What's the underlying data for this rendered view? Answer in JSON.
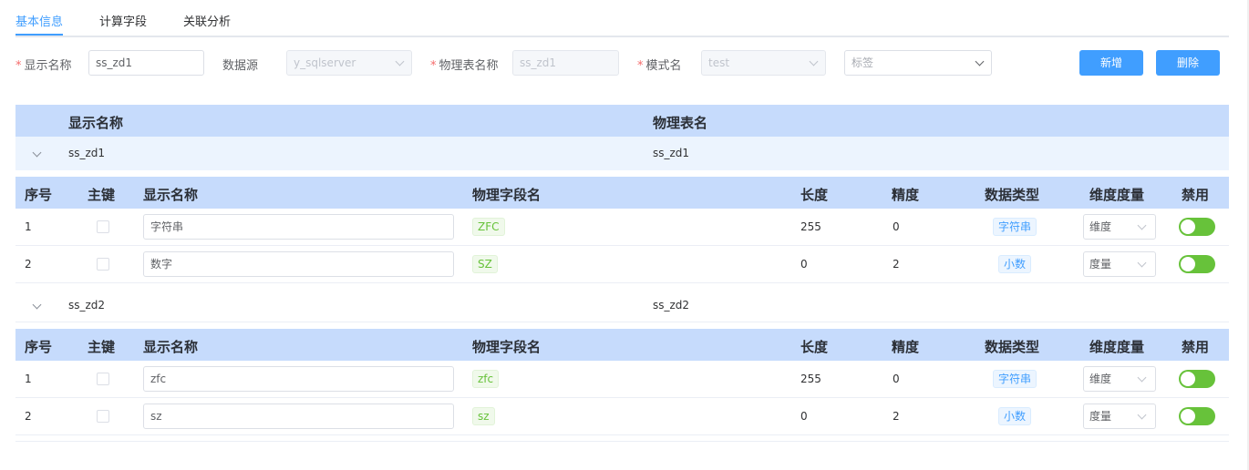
{
  "tabs": [
    {
      "label": "基本信息",
      "active": true
    },
    {
      "label": "计算字段",
      "active": false
    },
    {
      "label": "关联分析",
      "active": false
    }
  ],
  "form": {
    "display_name_label": "显示名称",
    "display_name_value": "ss_zd1",
    "datasource_label": "数据源",
    "datasource_value": "y_sqlserver",
    "physical_table_label": "物理表名称",
    "physical_table_value": "ss_zd1",
    "schema_label": "模式名",
    "schema_value": "test",
    "tag_placeholder": "标签",
    "add_button": "新增",
    "delete_button": "删除"
  },
  "master_table": {
    "columns": [
      "显示名称",
      "物理表名"
    ]
  },
  "detail_columns": [
    "序号",
    "主键",
    "显示名称",
    "物理字段名",
    "长度",
    "精度",
    "数据类型",
    "维度度量",
    "禁用"
  ],
  "groups": [
    {
      "display_name": "ss_zd1",
      "physical_name": "ss_zd1",
      "rows": [
        {
          "index": "1",
          "primary_key": false,
          "display_name": "字符串",
          "physical_field": "ZFC",
          "length": "255",
          "precision": "0",
          "data_type": "字符串",
          "dim_measure": "维度",
          "disabled": true
        },
        {
          "index": "2",
          "primary_key": false,
          "display_name": "数字",
          "physical_field": "SZ",
          "length": "0",
          "precision": "2",
          "data_type": "小数",
          "dim_measure": "度量",
          "disabled": true
        }
      ]
    },
    {
      "display_name": "ss_zd2",
      "physical_name": "ss_zd2",
      "rows": [
        {
          "index": "1",
          "primary_key": false,
          "display_name": "zfc",
          "physical_field": "zfc",
          "length": "255",
          "precision": "0",
          "data_type": "字符串",
          "dim_measure": "维度",
          "disabled": true
        },
        {
          "index": "2",
          "primary_key": false,
          "display_name": "sz",
          "physical_field": "sz",
          "length": "0",
          "precision": "2",
          "data_type": "小数",
          "dim_measure": "度量",
          "disabled": true
        }
      ]
    }
  ],
  "colors": {
    "primary": "#409eff",
    "header_bg": "#c6dbfc",
    "switch_on": "#67c23a",
    "required": "#f56c6c"
  }
}
